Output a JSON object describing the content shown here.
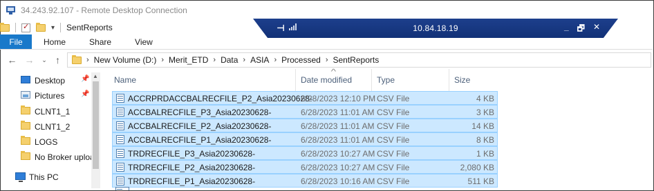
{
  "window": {
    "title": "34.243.92.107 - Remote Desktop Connection"
  },
  "connection_bar": {
    "host": "10.84.18.19",
    "pin_label": "⊣",
    "minimize_label": "_",
    "restore_label": "🗗",
    "close_label": "✕"
  },
  "quick_access": {
    "folder_title": "SentReports",
    "dropdown": "▾"
  },
  "ribbon": {
    "tabs": [
      {
        "label": "File"
      },
      {
        "label": "Home"
      },
      {
        "label": "Share"
      },
      {
        "label": "View"
      }
    ]
  },
  "nav": {
    "back": "←",
    "forward": "→",
    "recent": "⌄",
    "up": "↑",
    "path": [
      "New Volume (D:)",
      "Merit_ETD",
      "Data",
      "ASIA",
      "Processed",
      "SentReports"
    ],
    "separator": "›",
    "root_separator": "›"
  },
  "sidebar": {
    "items": [
      {
        "label": "Desktop",
        "pin": "📌"
      },
      {
        "label": "Pictures",
        "pin": "📌"
      },
      {
        "label": "CLNT1_1"
      },
      {
        "label": "CLNT1_2"
      },
      {
        "label": "LOGS"
      },
      {
        "label": "No Broker uploa"
      },
      {
        "label": "This PC"
      }
    ],
    "scroll_up": "▲"
  },
  "file_list": {
    "columns": [
      "Name",
      "Date modified",
      "Type",
      "Size"
    ],
    "sort_indicator": "^",
    "rows": [
      {
        "name": "ACCRPRDACCBALRECFILE_P2_Asia20230628-",
        "date": "6/28/2023 12:10 PM",
        "type": "CSV File",
        "size": "4 KB"
      },
      {
        "name": "ACCBALRECFILE_P3_Asia20230628-",
        "date": "6/28/2023 11:01 AM",
        "type": "CSV File",
        "size": "3 KB"
      },
      {
        "name": "ACCBALRECFILE_P2_Asia20230628-",
        "date": "6/28/2023 11:01 AM",
        "type": "CSV File",
        "size": "14 KB"
      },
      {
        "name": "ACCBALRECFILE_P1_Asia20230628-",
        "date": "6/28/2023 11:01 AM",
        "type": "CSV File",
        "size": "8 KB"
      },
      {
        "name": "TRDRECFILE_P3_Asia20230628-",
        "date": "6/28/2023 10:27 AM",
        "type": "CSV File",
        "size": "1 KB"
      },
      {
        "name": "TRDRECFILE_P2_Asia20230628-",
        "date": "6/28/2023 10:27 AM",
        "type": "CSV File",
        "size": "2,080 KB"
      },
      {
        "name": "TRDRECFILE_P1_Asia20230628-",
        "date": "6/28/2023 10:16 AM",
        "type": "CSV File",
        "size": "511 KB"
      }
    ]
  }
}
